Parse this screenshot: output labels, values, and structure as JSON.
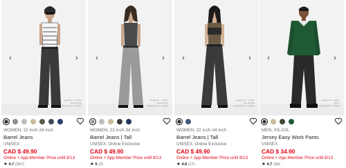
{
  "colors": {
    "price_red": "#e1061a",
    "photo_bg": "#f2f2f2",
    "text_gray": "#6a6a6a"
  },
  "products": [
    {
      "nav": {
        "prev_icon": "chevron-left-icon",
        "next_icon": "chevron-right-icon",
        "prev_glyph": "‹",
        "next_glyph": "›"
      },
      "size_note": {
        "line1": "Height 5'7\" / 170cm",
        "line2": "Size 28 inch",
        "line3": "Outerwear 5'7\" / 170cm"
      },
      "swatches": [
        "#2b2b2b",
        "#8e8e8e",
        "#bdbdbd",
        "#c9bd9c",
        "#5b5b4a",
        "#3f4a5a",
        "#28406b"
      ],
      "selected_swatch": 0,
      "meta": "WOMEN, 22 inch-34 inch",
      "name": "Barrel Jeans",
      "sub": "UNISEX",
      "price": "CAD $ 49.90",
      "promo": "Online + App-Member Price until 8/13",
      "rating_value": "4.7",
      "rating_count": "(997)"
    },
    {
      "nav": {
        "prev_icon": "chevron-left-icon",
        "next_icon": "chevron-right-icon",
        "prev_glyph": "‹",
        "next_glyph": "›"
      },
      "size_note": {
        "line1": "Height 5'7\" / 170cm",
        "line2": "Size 28 inch",
        "line3": "Outerwear 5'7\" / 170cm"
      },
      "swatches": [
        "#8e8e8e",
        "#bdbdbd",
        "#c9bd9c",
        "#3a3a3a",
        "#23365e"
      ],
      "selected_swatch": 0,
      "meta": "WOMEN, 22 inch-34 inch",
      "name": "Barrel Jeans | Tall",
      "sub": "UNISEX, Online Exclusive",
      "price": "CAD $ 49.90",
      "promo": "Online + App-Member Price until 8/13",
      "rating_value": "5",
      "rating_count": "(3)"
    },
    {
      "nav": {
        "prev_icon": "chevron-left-icon",
        "next_icon": "chevron-right-icon",
        "prev_glyph": "‹",
        "next_glyph": "›"
      },
      "size_note": {
        "line1": "Height 5'7\" / 170cm",
        "line2": "Size 28 inch",
        "line3": "Outerwear 5'7\" / 170cm"
      },
      "swatches": [
        "#2b2b2b",
        "#3f5a7a"
      ],
      "selected_swatch": 0,
      "meta": "WOMEN, 22 inch-34 inch",
      "name": "Barrel Jeans | Tall",
      "sub": "UNISEX, Online Exclusive",
      "price": "CAD $ 49.90",
      "promo": "Online + App-Member Price until 8/13",
      "rating_value": "4.6",
      "rating_count": "(17)"
    },
    {
      "nav": {
        "prev_icon": "chevron-left-icon",
        "next_icon": "chevron-right-icon",
        "prev_glyph": "‹",
        "next_glyph": "›"
      },
      "size_note": {
        "line1": "Height 6'1\" / 185cm",
        "line2": "Size L",
        "line3": "Outerwear 6'1\" / 185cm"
      },
      "swatches": [
        "#2b2b2b",
        "#c9bd9c",
        "#3e4a32",
        "#1f5a35"
      ],
      "selected_swatch": 0,
      "meta": "MEN, XS-XXL",
      "name": "Jersey Easy Work Pants",
      "sub": "UNISEX",
      "price": "CAD $ 34.90",
      "promo": "Online + App-Member Price until 8/13",
      "rating_value": "4.7",
      "rating_count": "(34)"
    }
  ]
}
